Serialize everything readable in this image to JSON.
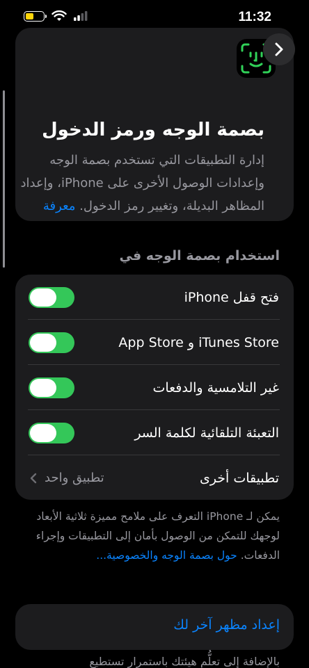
{
  "status_bar": {
    "time": "11:32",
    "battery_level": 0.45,
    "battery_color": "#ffd60a"
  },
  "header": {
    "icon": "faceid-icon",
    "back_icon": "chevron-right-icon",
    "title": "بصمة الوجه ورمز الدخول",
    "description": "إدارة التطبيقات التي تستخدم بصمة الوجه وإعدادات الوصول الأخرى على iPhone، وإعداد المظاهر البديلة، وتغيير رمز الدخول.",
    "learn_more": "معرفة المزيد..."
  },
  "section": {
    "label": "استخدام بصمة الوجه في"
  },
  "rows": [
    {
      "label": "فتح قفل iPhone",
      "on": true
    },
    {
      "label": "iTunes Store و App Store",
      "on": true
    },
    {
      "label": "غير التلامسية والدفعات",
      "on": true
    },
    {
      "label": "التعبئة التلقائية لكلمة السر",
      "on": true
    }
  ],
  "other_apps": {
    "label": "تطبيقات أخرى",
    "value": "تطبيق واحد"
  },
  "footer": {
    "text": "يمكن لـ iPhone التعرف على ملامح مميزة ثلاثية الأبعاد لوجهك للتمكن من الوصول بأمان إلى التطبيقات وإجراء الدفعات.",
    "link": "حول بصمة الوجه والخصوصية..."
  },
  "alternate": {
    "label": "إعداد مظهر آخر لك"
  },
  "bottom_text": "بالإضافة إلى تعلُّم هيئتك باستمرار تستطيع",
  "colors": {
    "accent": "#0a84ff",
    "toggle_on": "#34c759",
    "faceid_green": "#30d158"
  }
}
